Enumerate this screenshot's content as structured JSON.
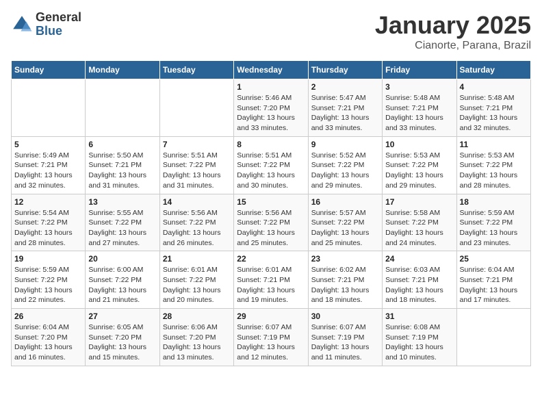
{
  "logo": {
    "general": "General",
    "blue": "Blue"
  },
  "title": "January 2025",
  "subtitle": "Cianorte, Parana, Brazil",
  "weekdays": [
    "Sunday",
    "Monday",
    "Tuesday",
    "Wednesday",
    "Thursday",
    "Friday",
    "Saturday"
  ],
  "weeks": [
    [
      {
        "day": "",
        "info": ""
      },
      {
        "day": "",
        "info": ""
      },
      {
        "day": "",
        "info": ""
      },
      {
        "day": "1",
        "info": "Sunrise: 5:46 AM\nSunset: 7:20 PM\nDaylight: 13 hours and 33 minutes."
      },
      {
        "day": "2",
        "info": "Sunrise: 5:47 AM\nSunset: 7:21 PM\nDaylight: 13 hours and 33 minutes."
      },
      {
        "day": "3",
        "info": "Sunrise: 5:48 AM\nSunset: 7:21 PM\nDaylight: 13 hours and 33 minutes."
      },
      {
        "day": "4",
        "info": "Sunrise: 5:48 AM\nSunset: 7:21 PM\nDaylight: 13 hours and 32 minutes."
      }
    ],
    [
      {
        "day": "5",
        "info": "Sunrise: 5:49 AM\nSunset: 7:21 PM\nDaylight: 13 hours and 32 minutes."
      },
      {
        "day": "6",
        "info": "Sunrise: 5:50 AM\nSunset: 7:21 PM\nDaylight: 13 hours and 31 minutes."
      },
      {
        "day": "7",
        "info": "Sunrise: 5:51 AM\nSunset: 7:22 PM\nDaylight: 13 hours and 31 minutes."
      },
      {
        "day": "8",
        "info": "Sunrise: 5:51 AM\nSunset: 7:22 PM\nDaylight: 13 hours and 30 minutes."
      },
      {
        "day": "9",
        "info": "Sunrise: 5:52 AM\nSunset: 7:22 PM\nDaylight: 13 hours and 29 minutes."
      },
      {
        "day": "10",
        "info": "Sunrise: 5:53 AM\nSunset: 7:22 PM\nDaylight: 13 hours and 29 minutes."
      },
      {
        "day": "11",
        "info": "Sunrise: 5:53 AM\nSunset: 7:22 PM\nDaylight: 13 hours and 28 minutes."
      }
    ],
    [
      {
        "day": "12",
        "info": "Sunrise: 5:54 AM\nSunset: 7:22 PM\nDaylight: 13 hours and 28 minutes."
      },
      {
        "day": "13",
        "info": "Sunrise: 5:55 AM\nSunset: 7:22 PM\nDaylight: 13 hours and 27 minutes."
      },
      {
        "day": "14",
        "info": "Sunrise: 5:56 AM\nSunset: 7:22 PM\nDaylight: 13 hours and 26 minutes."
      },
      {
        "day": "15",
        "info": "Sunrise: 5:56 AM\nSunset: 7:22 PM\nDaylight: 13 hours and 25 minutes."
      },
      {
        "day": "16",
        "info": "Sunrise: 5:57 AM\nSunset: 7:22 PM\nDaylight: 13 hours and 25 minutes."
      },
      {
        "day": "17",
        "info": "Sunrise: 5:58 AM\nSunset: 7:22 PM\nDaylight: 13 hours and 24 minutes."
      },
      {
        "day": "18",
        "info": "Sunrise: 5:59 AM\nSunset: 7:22 PM\nDaylight: 13 hours and 23 minutes."
      }
    ],
    [
      {
        "day": "19",
        "info": "Sunrise: 5:59 AM\nSunset: 7:22 PM\nDaylight: 13 hours and 22 minutes."
      },
      {
        "day": "20",
        "info": "Sunrise: 6:00 AM\nSunset: 7:22 PM\nDaylight: 13 hours and 21 minutes."
      },
      {
        "day": "21",
        "info": "Sunrise: 6:01 AM\nSunset: 7:22 PM\nDaylight: 13 hours and 20 minutes."
      },
      {
        "day": "22",
        "info": "Sunrise: 6:01 AM\nSunset: 7:21 PM\nDaylight: 13 hours and 19 minutes."
      },
      {
        "day": "23",
        "info": "Sunrise: 6:02 AM\nSunset: 7:21 PM\nDaylight: 13 hours and 18 minutes."
      },
      {
        "day": "24",
        "info": "Sunrise: 6:03 AM\nSunset: 7:21 PM\nDaylight: 13 hours and 18 minutes."
      },
      {
        "day": "25",
        "info": "Sunrise: 6:04 AM\nSunset: 7:21 PM\nDaylight: 13 hours and 17 minutes."
      }
    ],
    [
      {
        "day": "26",
        "info": "Sunrise: 6:04 AM\nSunset: 7:20 PM\nDaylight: 13 hours and 16 minutes."
      },
      {
        "day": "27",
        "info": "Sunrise: 6:05 AM\nSunset: 7:20 PM\nDaylight: 13 hours and 15 minutes."
      },
      {
        "day": "28",
        "info": "Sunrise: 6:06 AM\nSunset: 7:20 PM\nDaylight: 13 hours and 13 minutes."
      },
      {
        "day": "29",
        "info": "Sunrise: 6:07 AM\nSunset: 7:19 PM\nDaylight: 13 hours and 12 minutes."
      },
      {
        "day": "30",
        "info": "Sunrise: 6:07 AM\nSunset: 7:19 PM\nDaylight: 13 hours and 11 minutes."
      },
      {
        "day": "31",
        "info": "Sunrise: 6:08 AM\nSunset: 7:19 PM\nDaylight: 13 hours and 10 minutes."
      },
      {
        "day": "",
        "info": ""
      }
    ]
  ]
}
